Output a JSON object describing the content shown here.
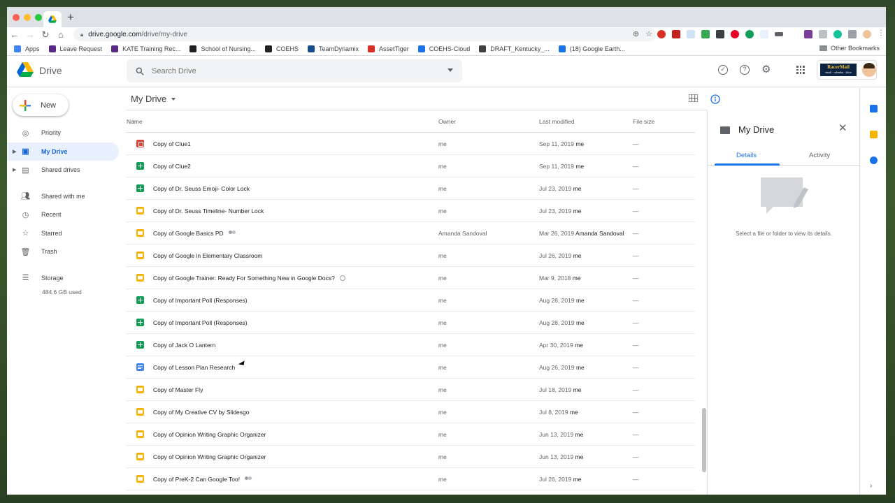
{
  "browser": {
    "url_host": "drive.google.com",
    "url_path": "/drive/my-drive",
    "bookmarks": [
      {
        "label": "Apps",
        "color": "#4285f4"
      },
      {
        "label": "Leave Request",
        "color": "#5b2a86"
      },
      {
        "label": "KATE Training Rec...",
        "color": "#5b2a86"
      },
      {
        "label": "School of Nursing...",
        "color": "#202124"
      },
      {
        "label": "COEHS",
        "color": "#202124"
      },
      {
        "label": "TeamDynamix",
        "color": "#1a4d8f"
      },
      {
        "label": "AssetTiger",
        "color": "#d93025"
      },
      {
        "label": "COEHS-Cloud",
        "color": "#1a73e8"
      },
      {
        "label": "DRAFT_Kentucky_...",
        "color": "#3c4043"
      },
      {
        "label": "(18) Google Earth...",
        "color": "#1a73e8"
      }
    ],
    "other_bookmarks": "Other Bookmarks"
  },
  "header": {
    "app_name": "Drive",
    "search_placeholder": "Search Drive",
    "brand_badge": "RacerMail",
    "brand_sub": "email · calendar · drive"
  },
  "sidebar": {
    "new_label": "New",
    "items": [
      {
        "label": "Priority",
        "icon": "check-circle-icon"
      },
      {
        "label": "My Drive",
        "icon": "my-drive-icon",
        "active": true
      },
      {
        "label": "Shared drives",
        "icon": "shared-drives-icon"
      },
      {
        "label": "Shared with me",
        "icon": "people-icon"
      },
      {
        "label": "Recent",
        "icon": "clock-icon"
      },
      {
        "label": "Starred",
        "icon": "star-icon"
      },
      {
        "label": "Trash",
        "icon": "trash-icon"
      }
    ],
    "storage_label": "Storage",
    "storage_used": "484.6 GB used"
  },
  "main": {
    "title": "My Drive",
    "columns": {
      "name": "Name",
      "owner": "Owner",
      "modified": "Last modified",
      "size": "File size"
    },
    "files": [
      {
        "type": "jamboard",
        "name": "Copy of Clue1",
        "owner": "me",
        "modified": "Sep 11, 2019",
        "modified_by": "me",
        "size": "—"
      },
      {
        "type": "sheets",
        "name": "Copy of Clue2",
        "owner": "me",
        "modified": "Sep 11, 2019",
        "modified_by": "me",
        "size": "—"
      },
      {
        "type": "sheets",
        "name": "Copy of Dr. Seuss Emoji- Color Lock",
        "owner": "me",
        "modified": "Jul 23, 2019",
        "modified_by": "me",
        "size": "—"
      },
      {
        "type": "slides",
        "name": "Copy of Dr. Seuss Timeline- Number Lock",
        "owner": "me",
        "modified": "Jul 23, 2019",
        "modified_by": "me",
        "size": "—"
      },
      {
        "type": "slides",
        "name": "Copy of Google Basics PD",
        "shared": true,
        "owner": "Amanda Sandoval",
        "modified": "Mar 26, 2019",
        "modified_by": "Amanda Sandoval",
        "size": "—"
      },
      {
        "type": "slides",
        "name": "Copy of Google in Elementary Classroom",
        "owner": "me",
        "modified": "Jul 26, 2019",
        "modified_by": "me",
        "size": "—"
      },
      {
        "type": "slides",
        "name": "Copy of Google Trainer: Ready For Something New in Google Docs?",
        "badge": true,
        "owner": "me",
        "modified": "Mar 9, 2018",
        "modified_by": "me",
        "size": "—"
      },
      {
        "type": "sheets",
        "name": "Copy of Important Poll (Responses)",
        "owner": "me",
        "modified": "Aug 28, 2019",
        "modified_by": "me",
        "size": "—"
      },
      {
        "type": "sheets",
        "name": "Copy of Important Poll (Responses)",
        "owner": "me",
        "modified": "Aug 28, 2019",
        "modified_by": "me",
        "size": "—"
      },
      {
        "type": "sheets",
        "name": "Copy of Jack O Lantern",
        "owner": "me",
        "modified": "Apr 30, 2019",
        "modified_by": "me",
        "size": "—"
      },
      {
        "type": "docs",
        "name": "Copy of Lesson Plan Research",
        "owner": "me",
        "modified": "Aug 26, 2019",
        "modified_by": "me",
        "size": "—"
      },
      {
        "type": "slides",
        "name": "Copy of Master Fly",
        "owner": "me",
        "modified": "Jul 18, 2019",
        "modified_by": "me",
        "size": "—"
      },
      {
        "type": "slides",
        "name": "Copy of My Creative CV by Slidesgo",
        "owner": "me",
        "modified": "Jul 8, 2019",
        "modified_by": "me",
        "size": "—"
      },
      {
        "type": "slides",
        "name": "Copy of Opinion Writing Graphic Organizer",
        "owner": "me",
        "modified": "Jun 13, 2019",
        "modified_by": "me",
        "size": "—"
      },
      {
        "type": "slides",
        "name": "Copy of Opinion Writing Graphic Organizer",
        "owner": "me",
        "modified": "Jun 13, 2019",
        "modified_by": "me",
        "size": "—"
      },
      {
        "type": "slides",
        "name": "Copy of PreK-2 Can Google Too!",
        "shared": true,
        "owner": "me",
        "modified": "Jul 26, 2019",
        "modified_by": "me",
        "size": "—"
      }
    ]
  },
  "details": {
    "title": "My Drive",
    "tab_details": "Details",
    "tab_activity": "Activity",
    "empty_message": "Select a file or folder to view its details."
  },
  "colors": {
    "accent": "#1a73e8",
    "active_bg": "#e8f0fe",
    "slides": "#f4b400",
    "sheets": "#0f9d58",
    "docs": "#4285f4",
    "jamboard": "#db4437"
  }
}
